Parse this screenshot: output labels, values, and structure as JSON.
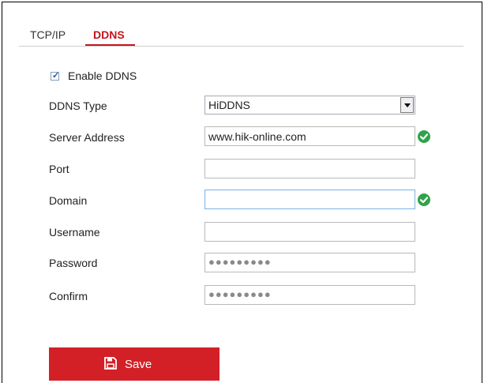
{
  "tabs": [
    {
      "label": "TCP/IP",
      "active": false
    },
    {
      "label": "DDNS",
      "active": true
    }
  ],
  "form": {
    "enable_ddns": {
      "label": "Enable DDNS",
      "checked": true
    },
    "ddns_type": {
      "label": "DDNS Type",
      "value": "HiDDNS"
    },
    "server_address": {
      "label": "Server Address",
      "value": "www.hik-online.com",
      "status": "valid"
    },
    "port": {
      "label": "Port",
      "value": ""
    },
    "domain": {
      "label": "Domain",
      "value": "",
      "status": "valid"
    },
    "username": {
      "label": "Username",
      "value": ""
    },
    "password": {
      "label": "Password",
      "value": "●●●●●●●●●"
    },
    "confirm": {
      "label": "Confirm",
      "value": "●●●●●●●●●"
    }
  },
  "actions": {
    "save_label": "Save"
  },
  "colors": {
    "accent": "#d32027",
    "valid": "#2fa34a",
    "tab_active": "#c4161c"
  }
}
